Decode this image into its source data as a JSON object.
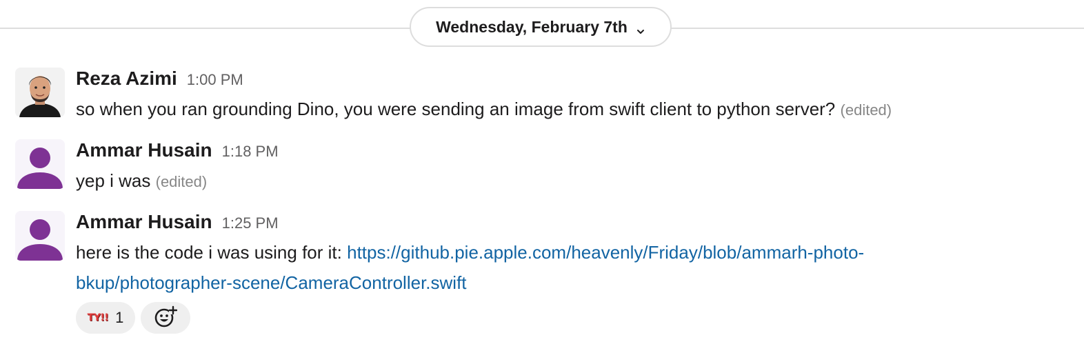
{
  "date_divider": {
    "label": "Wednesday, February 7th",
    "chevron_icon": "chevron-down-icon"
  },
  "messages": [
    {
      "sender": "Reza Azimi",
      "time": "1:00 PM",
      "avatar": "user-photo-avatar",
      "text": "so when you ran grounding Dino, you were sending an image from swift client to python server?",
      "edited": "(edited)"
    },
    {
      "sender": "Ammar Husain",
      "time": "1:18 PM",
      "avatar": "default-person-avatar",
      "text": "yep i was",
      "edited": "(edited)"
    },
    {
      "sender": "Ammar Husain",
      "time": "1:25 PM",
      "avatar": "default-person-avatar",
      "text": "here is the code i was using for it:",
      "link": "https://github.pie.apple.com/heavenly/Friday/blob/ammarh-photo-bkup/photographer-scene/CameraController.swift",
      "reactions": [
        {
          "emoji_text": "TY!!",
          "count": "1"
        }
      ],
      "add_reaction_icon": "add-reaction-icon"
    }
  ],
  "colors": {
    "link": "#1264a3",
    "avatar_purple": "#7e3294",
    "reaction_bg": "#efefef"
  }
}
